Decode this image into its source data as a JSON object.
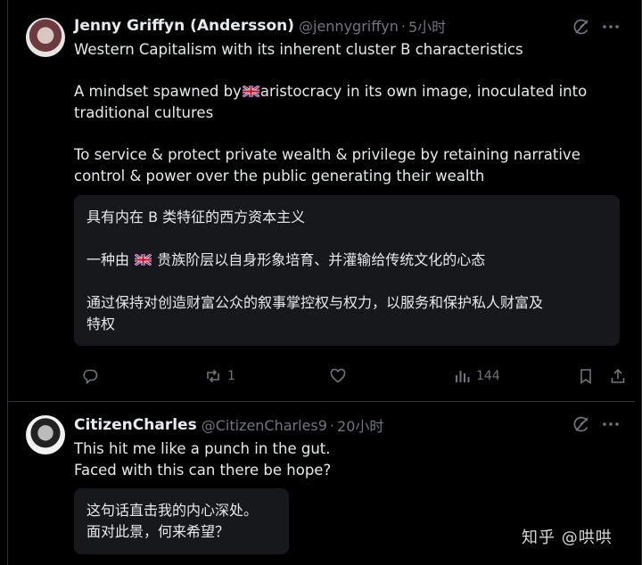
{
  "tweet1": {
    "display_name": "Jenny Griffyn (Andersson)",
    "handle": "@jennygriffyn",
    "separator": "·",
    "time": "5小时",
    "paragraphs": {
      "p1": "Western Capitalism with its inherent cluster B characteristics",
      "p2_before_flag": "A mindset spawned by",
      "p2_after_flag": "aristocracy in its own image, inoculated into traditional cultures",
      "p3": "To service & protect private wealth & privilege by retaining narrative control & power over the public generating their wealth"
    },
    "translation": {
      "line1": "具有内在 B 类特征的西方资本主义",
      "line2_before_flag": "一种由",
      "line2_after_flag": "贵族阶层以自身形象培育、并灌输给传统文化的心态",
      "line3a": "通过保持对创造财富公众的叙事掌控权与权力，以服务和保护私人财富及",
      "line3b": "特权"
    },
    "actions": {
      "reply_count": "",
      "retweet_count": "1",
      "like_count": "",
      "views_count": "144"
    },
    "avatar_icon": "user-avatar"
  },
  "tweet2": {
    "display_name": "CitizenCharles",
    "handle": "@CitizenCharles9",
    "separator": "·",
    "time": "20小时",
    "text_line1": "This hit me like a punch in the gut.",
    "text_line2": "Faced with this can there be hope?",
    "translation": {
      "line1": "这句话直击我的内心深处。",
      "line2": "面对此景，何来希望？"
    },
    "avatar_icon": "user-avatar"
  },
  "watermark": "知乎 @哄哄",
  "colors": {
    "background": "#000000",
    "text": "#e7e9ea",
    "muted": "#71767b",
    "card": "#16181c",
    "border": "#2f3336"
  },
  "icons": [
    "grok-icon",
    "more-icon",
    "reply-icon",
    "retweet-icon",
    "like-icon",
    "views-icon",
    "bookmark-icon",
    "share-icon",
    "uk-flag-icon"
  ]
}
